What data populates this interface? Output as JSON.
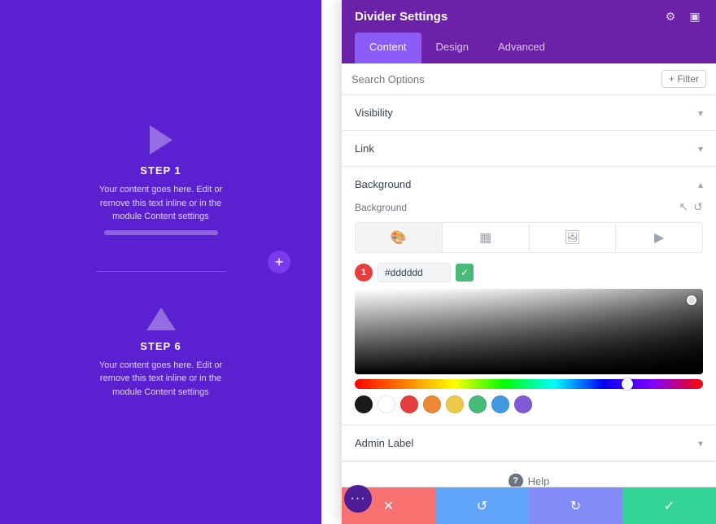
{
  "canvas": {
    "step1": {
      "title": "STEP 1",
      "desc": "Your content goes here. Edit or remove this text inline or in the module Content settings"
    },
    "step6": {
      "title": "STEP 6",
      "desc": "Your content goes here. Edit or remove this text inline or in the module Content settings"
    },
    "add_btn": "+"
  },
  "panel": {
    "title": "Divider Settings",
    "tabs": [
      "Content",
      "Design",
      "Advanced"
    ],
    "active_tab": "Content",
    "search_placeholder": "Search Options",
    "filter_label": "+ Filter",
    "sections": {
      "visibility": {
        "label": "Visibility"
      },
      "link": {
        "label": "Link"
      },
      "background": {
        "label": "Background"
      },
      "admin_label": {
        "label": "Admin Label"
      }
    },
    "background": {
      "label": "Background",
      "color_hex": "#dddddd",
      "type_tabs": [
        "color",
        "gradient",
        "image",
        "video"
      ]
    },
    "help_label": "Help",
    "footer": {
      "cancel": "✕",
      "undo": "↺",
      "redo": "↻",
      "save": "✓"
    }
  },
  "swatches": [
    {
      "color": "#1a1a1a",
      "label": "black"
    },
    {
      "color": "#ffffff",
      "label": "white"
    },
    {
      "color": "#e53e3e",
      "label": "red"
    },
    {
      "color": "#ed8936",
      "label": "orange"
    },
    {
      "color": "#ecc94b",
      "label": "yellow"
    },
    {
      "color": "#48bb78",
      "label": "green"
    },
    {
      "color": "#4299e1",
      "label": "blue"
    },
    {
      "color": "#805ad5",
      "label": "purple"
    }
  ]
}
